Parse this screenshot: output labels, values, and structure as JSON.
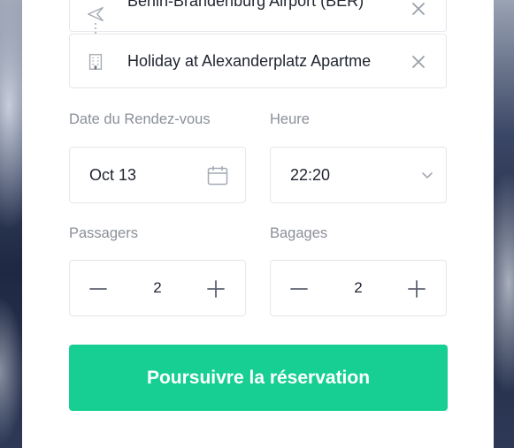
{
  "route": {
    "origin": {
      "value": "Berlin-Brandenburg Airport (BER)",
      "icon": "airplane-icon"
    },
    "destination": {
      "value": "Holiday at Alexanderplatz Apartme",
      "icon": "building-icon"
    }
  },
  "date": {
    "label": "Date du Rendez-vous",
    "value": "Oct 13",
    "icon": "calendar-icon"
  },
  "time": {
    "label": "Heure",
    "value": "22:20",
    "icon": "chevron-down-icon"
  },
  "passengers": {
    "label": "Passagers",
    "value": "2"
  },
  "luggage": {
    "label": "Bagages",
    "value": "2"
  },
  "submit": {
    "label": "Poursuivre la réservation"
  },
  "colors": {
    "accent": "#17cf92",
    "border": "#e4e7ec",
    "label": "#8a8f99",
    "text": "#1f2430"
  }
}
